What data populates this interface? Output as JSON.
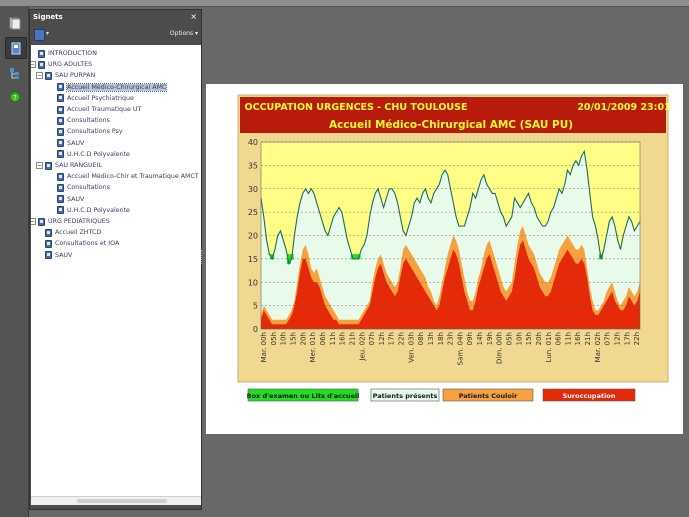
{
  "app": {
    "toolstrip": [
      {
        "name": "pages-icon"
      },
      {
        "name": "bookmarks-icon"
      },
      {
        "name": "layers-icon"
      },
      {
        "name": "help-icon"
      }
    ]
  },
  "panel": {
    "title": "Signets",
    "close": "×",
    "options": "Options ▾"
  },
  "tree": [
    {
      "label": "INTRODUCTION",
      "level": 0,
      "toggle": ""
    },
    {
      "label": "URG ADULTES",
      "level": 0,
      "toggle": "−"
    },
    {
      "label": "SAU PURPAN",
      "level": 1,
      "toggle": "−"
    },
    {
      "label": "Accueil Médico-Chirurgical AMC",
      "level": 2,
      "toggle": "",
      "selected": true
    },
    {
      "label": "Accueil Psychiatrique",
      "level": 2,
      "toggle": ""
    },
    {
      "label": "Accueil Traumatique UT",
      "level": 2,
      "toggle": ""
    },
    {
      "label": "Consultations",
      "level": 2,
      "toggle": ""
    },
    {
      "label": "Consultations Psy",
      "level": 2,
      "toggle": ""
    },
    {
      "label": "SAUV",
      "level": 2,
      "toggle": ""
    },
    {
      "label": "U.H.C.D Polyvalente",
      "level": 2,
      "toggle": ""
    },
    {
      "label": "SAU RANGUEIL",
      "level": 1,
      "toggle": "−"
    },
    {
      "label": "Accueil Médico-Chir et Traumatique AMCT",
      "level": 2,
      "toggle": ""
    },
    {
      "label": "Consultations",
      "level": 2,
      "toggle": ""
    },
    {
      "label": "SAUV",
      "level": 2,
      "toggle": ""
    },
    {
      "label": "U.H.C.D Polyvalente",
      "level": 2,
      "toggle": ""
    },
    {
      "label": "URG PEDIATRIQUES",
      "level": 0,
      "toggle": "−"
    },
    {
      "label": "Accueil ZHTCD",
      "level": 1,
      "toggle": ""
    },
    {
      "label": "Consultations et IOA",
      "level": 1,
      "toggle": ""
    },
    {
      "label": "SAUV",
      "level": 1,
      "toggle": ""
    }
  ],
  "chart_data": {
    "type": "area",
    "title": "OCCUPATION   URGENCES   -    CHU TOULOUSE",
    "timestamp": "20/01/2009 23:01",
    "subtitle": "Accueil Médico-Chirurgical AMC     (SAU PU)",
    "ylim": [
      0,
      40
    ],
    "yticks": [
      0,
      5,
      10,
      15,
      20,
      25,
      30,
      35,
      40
    ],
    "xticks": [
      "Mar. 00h",
      "05h",
      "10h",
      "15h",
      "20h",
      "Mer. 01h",
      "06h",
      "11h",
      "16h",
      "21h",
      "Jeu. 02h",
      "07h",
      "12h",
      "17h",
      "22h",
      "Ven. 03h",
      "08h",
      "13h",
      "18h",
      "23h",
      "Sam. 04h",
      "09h",
      "14h",
      "19h",
      "Dim. 00h",
      "05h",
      "10h",
      "15h",
      "20h",
      "Lun. 01h",
      "06h",
      "11h",
      "16h",
      "21h",
      "Mar. 02h",
      "07h",
      "12h",
      "17h",
      "22h"
    ],
    "capacity_line": 25,
    "colors": {
      "title_bg": "#b81a0c",
      "title_text": "#ffff22",
      "plot_bg": "#ffff88",
      "frame": "#f0d890",
      "present": "#e8fbea",
      "present_line": "#1a6e5e",
      "couloir": "#f7a040",
      "suroccupation": "#e42a08",
      "box": "#22dd22"
    },
    "series": [
      {
        "name": "Patients présents",
        "values": [
          28,
          24,
          19,
          16,
          15,
          17,
          20,
          21,
          19,
          17,
          14,
          15,
          20,
          24,
          27,
          29,
          30,
          29,
          30,
          29,
          27,
          25,
          23,
          21,
          20,
          22,
          24,
          25,
          26,
          25,
          22,
          19,
          17,
          15,
          15,
          15,
          17,
          18,
          20,
          24,
          27,
          29,
          30,
          28,
          26,
          28,
          30,
          30,
          29,
          27,
          24,
          21,
          20,
          22,
          24,
          27,
          28,
          27,
          29,
          30,
          28,
          27,
          29,
          30,
          31,
          33,
          34,
          33,
          30,
          27,
          24,
          22,
          22,
          22,
          24,
          26,
          29,
          28,
          30,
          32,
          33,
          31,
          30,
          29,
          29,
          27,
          25,
          24,
          22,
          23,
          24,
          28,
          27,
          26,
          27,
          28,
          29,
          27,
          26,
          24,
          23,
          22,
          22,
          23,
          25,
          26,
          28,
          30,
          29,
          31,
          34,
          33,
          35,
          36,
          35,
          37,
          38,
          34,
          29,
          24,
          22,
          19,
          15,
          17,
          20,
          23,
          24,
          22,
          19,
          17,
          20,
          22,
          24,
          23,
          21,
          22,
          23
        ]
      },
      {
        "name": "Patients Couloir",
        "values": [
          3,
          5,
          4,
          3,
          2,
          2,
          2,
          2,
          2,
          2,
          3,
          4,
          6,
          10,
          14,
          17,
          18,
          16,
          13,
          12,
          13,
          11,
          9,
          7,
          6,
          5,
          4,
          3,
          2,
          2,
          2,
          2,
          2,
          2,
          2,
          2,
          3,
          4,
          5,
          6,
          10,
          13,
          15,
          16,
          14,
          12,
          11,
          10,
          9,
          10,
          13,
          17,
          18,
          17,
          16,
          15,
          14,
          13,
          12,
          11,
          9,
          8,
          6,
          5,
          7,
          10,
          13,
          16,
          18,
          20,
          19,
          17,
          14,
          11,
          8,
          6,
          6,
          8,
          11,
          13,
          16,
          18,
          19,
          17,
          15,
          13,
          11,
          9,
          8,
          9,
          10,
          14,
          18,
          21,
          22,
          20,
          18,
          17,
          16,
          14,
          12,
          11,
          10,
          10,
          11,
          13,
          15,
          17,
          18,
          19,
          20,
          19,
          18,
          17,
          17,
          18,
          17,
          13,
          9,
          6,
          4,
          4,
          5,
          6,
          8,
          9,
          10,
          8,
          6,
          5,
          6,
          7,
          9,
          8,
          7,
          8,
          10
        ]
      },
      {
        "name": "Suroccupation",
        "values": [
          2,
          4,
          3,
          2,
          1,
          1,
          1,
          1,
          1,
          1,
          2,
          3,
          5,
          8,
          12,
          15,
          15,
          13,
          11,
          10,
          10,
          9,
          7,
          5,
          4,
          3,
          2,
          2,
          1,
          1,
          1,
          1,
          1,
          1,
          1,
          1,
          2,
          3,
          4,
          5,
          8,
          11,
          13,
          14,
          12,
          10,
          9,
          8,
          7,
          8,
          11,
          14,
          15,
          14,
          13,
          12,
          11,
          10,
          9,
          8,
          7,
          6,
          5,
          4,
          5,
          8,
          11,
          13,
          15,
          17,
          16,
          14,
          11,
          8,
          6,
          4,
          4,
          6,
          9,
          11,
          13,
          15,
          16,
          14,
          12,
          10,
          8,
          7,
          6,
          7,
          8,
          11,
          15,
          18,
          19,
          17,
          15,
          14,
          13,
          11,
          9,
          8,
          7,
          7,
          8,
          10,
          12,
          14,
          15,
          16,
          17,
          16,
          15,
          14,
          14,
          15,
          14,
          11,
          7,
          4,
          3,
          3,
          4,
          5,
          6,
          7,
          8,
          6,
          5,
          4,
          4,
          5,
          7,
          6,
          5,
          6,
          8
        ]
      },
      {
        "name": "Box d'examen ou Lits d'accueil",
        "values": [
          0,
          0,
          0,
          0,
          0,
          0,
          0,
          0,
          0,
          0,
          0,
          0,
          0,
          0,
          0,
          0,
          0,
          0,
          0,
          0,
          0,
          0,
          0,
          0,
          0,
          0,
          0,
          0,
          0,
          0,
          0,
          0,
          0,
          0,
          0,
          0,
          0,
          0,
          0,
          0,
          0,
          0,
          0,
          0,
          0,
          0,
          0,
          0,
          0,
          0,
          0,
          0,
          0,
          0,
          0,
          0,
          0,
          0,
          0,
          0,
          0,
          0,
          0,
          0,
          0,
          0,
          0,
          0,
          0,
          0,
          0,
          0,
          0,
          0,
          0,
          0,
          0,
          0,
          0,
          0,
          0,
          0,
          0,
          0,
          0,
          0,
          0,
          0,
          0,
          0,
          0,
          0,
          0,
          0,
          0,
          0,
          0,
          0,
          0,
          0,
          0,
          0,
          0,
          0,
          0,
          0,
          0,
          0,
          0,
          0,
          0,
          0,
          0,
          0,
          0,
          0,
          0,
          0,
          0,
          0,
          0,
          0,
          0,
          0,
          0,
          0,
          0,
          0,
          0,
          0,
          0,
          0,
          0,
          0,
          0,
          0,
          0
        ]
      }
    ],
    "legend": [
      {
        "label": "Box d'examen ou Lits d'accueil",
        "color": "#22dd22"
      },
      {
        "label": "Patients présents",
        "color": "#e8fbea"
      },
      {
        "label": "Patients Couloir",
        "color": "#f7a040"
      },
      {
        "label": "Suroccupation",
        "color": "#e42a08"
      }
    ]
  }
}
